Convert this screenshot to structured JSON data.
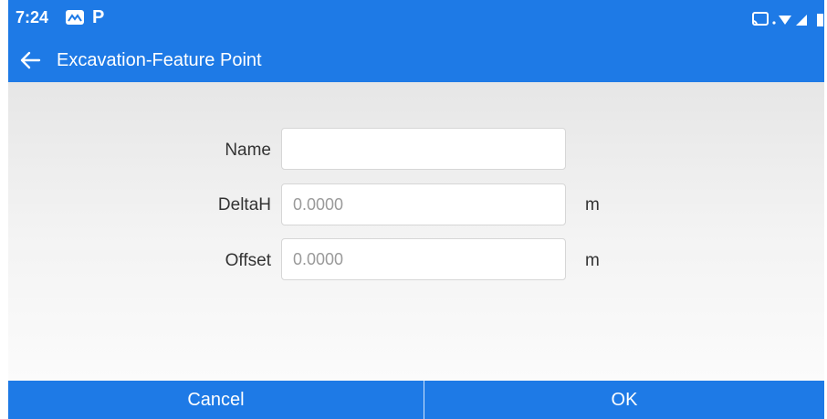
{
  "status_bar": {
    "time": "7:24",
    "notification_icons": [
      "mail-icon",
      "p-app-icon"
    ],
    "system_icons": [
      "cast-icon",
      "wifi-icon",
      "signal-icon",
      "battery-icon"
    ],
    "p_glyph": "P"
  },
  "app_bar": {
    "title": "Excavation-Feature Point",
    "back_icon": "arrow-left-icon"
  },
  "form": {
    "fields": [
      {
        "label": "Name",
        "value": "",
        "placeholder": "",
        "unit": ""
      },
      {
        "label": "DeltaH",
        "value": "",
        "placeholder": "0.0000",
        "unit": "m"
      },
      {
        "label": "Offset",
        "value": "",
        "placeholder": "0.0000",
        "unit": "m"
      }
    ]
  },
  "buttons": {
    "cancel": "Cancel",
    "ok": "OK"
  },
  "colors": {
    "primary": "#1e7ae6",
    "background_top": "#e6e6e6",
    "background_bottom": "#fbfbfb",
    "text": "#333333"
  }
}
